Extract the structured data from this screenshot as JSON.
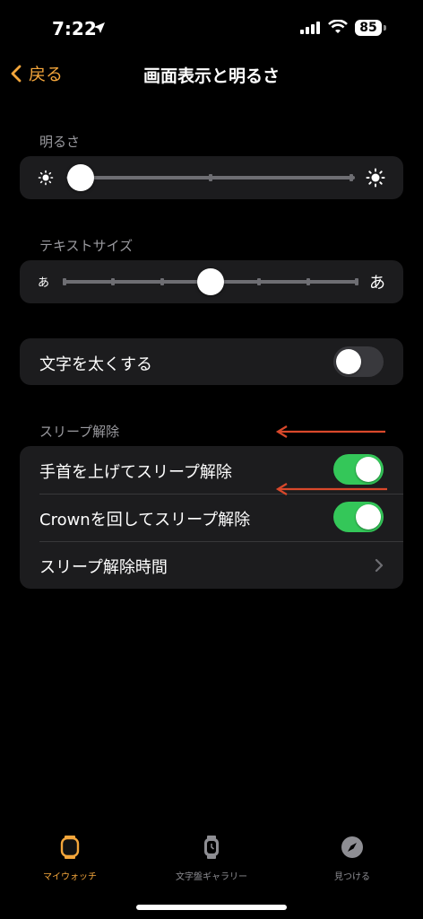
{
  "status": {
    "time": "7:22",
    "battery": "85"
  },
  "nav": {
    "back_label": "戻る",
    "title": "画面表示と明るさ"
  },
  "brightness": {
    "section_label": "明るさ",
    "level": 0.05
  },
  "text_size": {
    "section_label": "テキストサイズ",
    "small_glyph": "あ",
    "large_glyph": "あ",
    "level": 0.5,
    "steps": 7
  },
  "bold_text": {
    "label": "文字を太くする",
    "enabled": false
  },
  "wake": {
    "section_label": "スリープ解除",
    "rows": [
      {
        "label": "手首を上げてスリープ解除",
        "enabled": true
      },
      {
        "label": "Crownを回してスリープ解除",
        "enabled": true
      },
      {
        "label": "スリープ解除時間"
      }
    ]
  },
  "tabs": [
    {
      "label": "マイウォッチ",
      "icon": "watch-icon",
      "active": true
    },
    {
      "label": "文字盤ギャラリー",
      "icon": "watch-face-icon",
      "active": false
    },
    {
      "label": "見つける",
      "icon": "compass-icon",
      "active": false
    }
  ],
  "colors": {
    "accent": "#f4a63b",
    "toggle_on": "#34c759",
    "annotation_arrow": "#d9482b"
  }
}
